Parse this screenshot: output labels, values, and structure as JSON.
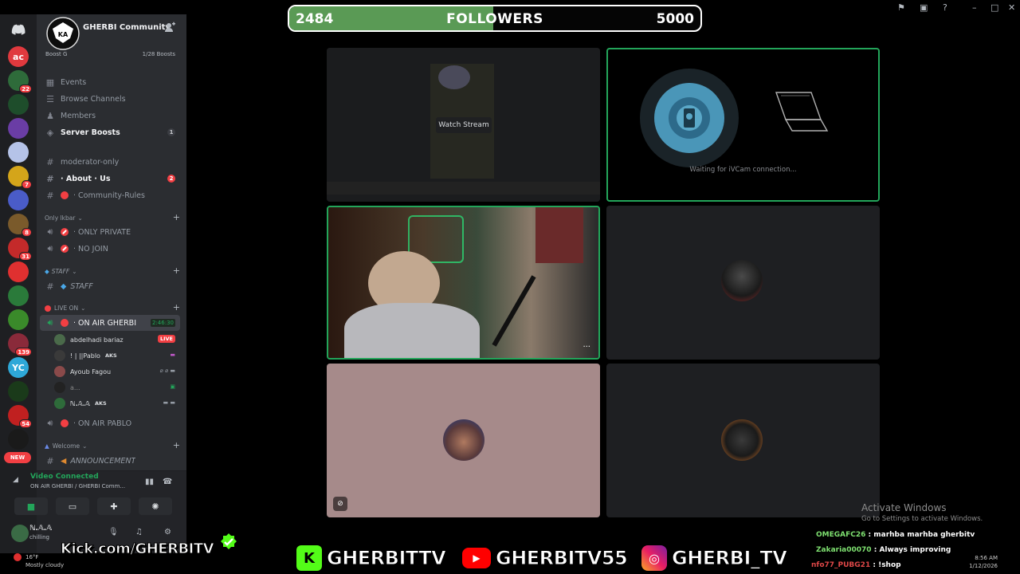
{
  "follower_goal": {
    "current": "2484",
    "label": "FOLLOWERS",
    "target": "5000",
    "progress": 0.4968,
    "server_caption": "GHERBI Community"
  },
  "sidebar": {
    "server_name": "GHERBI Community",
    "boost_goal": "Boost G",
    "boost_count": "1/28 Boosts",
    "items": [
      {
        "label": "Events",
        "icon": "calendar-icon"
      },
      {
        "label": "Browse Channels",
        "icon": "browse-icon"
      },
      {
        "label": "Members",
        "icon": "members-icon"
      },
      {
        "label": "Server Boosts",
        "icon": "boost-icon",
        "count": "1"
      }
    ],
    "channels": [
      {
        "label": "moderator-only"
      },
      {
        "label": "· About · Us",
        "count": "2"
      },
      {
        "label": "· Community-Rules"
      }
    ],
    "categories": {
      "only": "Only lkbar",
      "staff": "STAFF",
      "live": "LIVE ON",
      "welcome": "Welcome"
    },
    "voice_channels": {
      "private": "· ONLY PRIVATE",
      "nojoin": "· NO JOIN",
      "staff": "STAFF",
      "onair": "· ON AIR GHERBI",
      "onair_time": "2:46:30",
      "pablo": "· ON AIR PABLO",
      "announcement": "ANNOUNCEMENT"
    },
    "voice_users": [
      {
        "name": "abdelhadi bariaz",
        "badge": "LIVE"
      },
      {
        "name": "! | ||Pablo",
        "tag": "AKS"
      },
      {
        "name": "Ayoub Fagou"
      },
      {
        "name": "a..."
      },
      {
        "name": "ℕ.𝔸.𝔸",
        "tag": "AKS"
      }
    ],
    "voice_panel": {
      "status": "Video Connected",
      "channel": "ON AIR GHERBI / GHERBI Comm..."
    },
    "user": {
      "name": "ℕ.𝔸.𝔸",
      "status": "chilling"
    }
  },
  "rail": {
    "badges": [
      "22",
      "7",
      "8",
      "31",
      "139",
      "54"
    ],
    "new_label": "NEW"
  },
  "tiles": {
    "watch_stream": "Watch Stream",
    "ivcam_waiting": "Waiting for iVCam connection...",
    "tile_menu": "···"
  },
  "activate": {
    "title": "Activate Windows",
    "subtitle": "Go to Settings to activate Windows."
  },
  "chat": [
    {
      "user": "OMEGAFC26",
      "message": ": marhba marhba gherbitv"
    },
    {
      "user": "Zakaria00070",
      "message": ": Always improving"
    },
    {
      "user": "nfo77_PUBG21",
      "message": ": !shop"
    }
  ],
  "banner": {
    "kick": "Kick.com/GHERBITV",
    "kick_name": "GHERBITTV",
    "youtube_name": "GHERBITV55",
    "instagram_name": "GHERBI_TV"
  },
  "taskbar": {
    "temp": "16°F",
    "weather": "Mostly cloudy",
    "time": "8:56 AM",
    "date": "1/12/2026"
  },
  "colors": {
    "accent_green": "#23a55a",
    "red": "#f23f43",
    "sidebar_bg": "#2b2d31",
    "kick_green": "#53fc18",
    "youtube_red": "#ff0000"
  }
}
